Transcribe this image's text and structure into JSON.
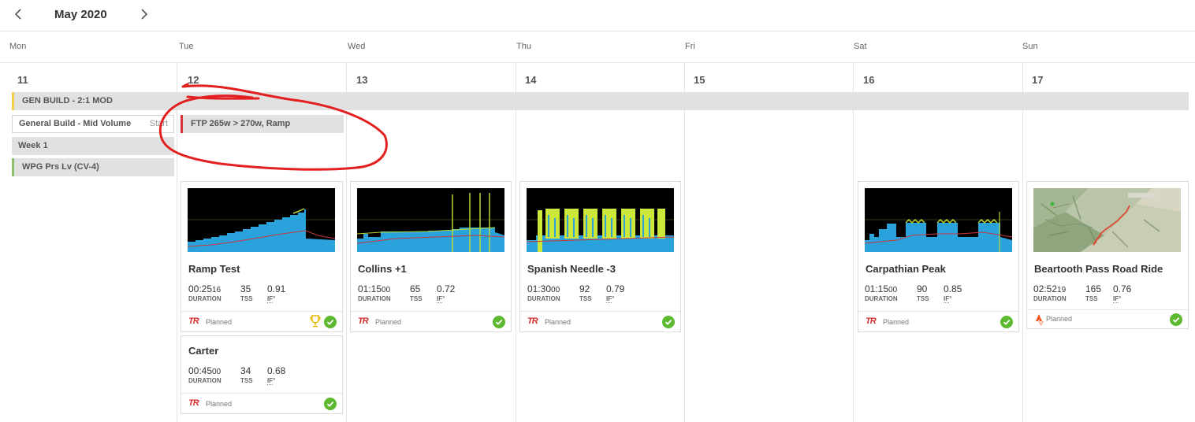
{
  "header": {
    "month": "May 2020",
    "prev_icon": "chevron-left-icon",
    "next_icon": "chevron-right-icon"
  },
  "weekdays": [
    "Mon",
    "Tue",
    "Wed",
    "Thu",
    "Fri",
    "Sat",
    "Sun"
  ],
  "days": [
    "11",
    "12",
    "13",
    "14",
    "15",
    "16",
    "17"
  ],
  "plan": {
    "gen_build": "GEN BUILD - 2:1 MOD",
    "general_build": "General Build - Mid Volume",
    "start": "Start",
    "week": "Week 1",
    "wpg": "WPG Prs Lv (CV-4)",
    "ftp_note": "FTP 265w > 270w, Ramp"
  },
  "labels": {
    "duration": "DURATION",
    "tss": "TSS",
    "if": "IF",
    "planned": "Planned",
    "tr_logo": "TR"
  },
  "workouts": [
    {
      "title": "Ramp Test",
      "dur_main": "00:25",
      "dur_sec": "16",
      "tss": "35",
      "if": "0.91"
    },
    {
      "title": "Carter",
      "dur_main": "00:45",
      "dur_sec": "00",
      "tss": "34",
      "if": "0.68"
    },
    {
      "title": "Collins +1",
      "dur_main": "01:15",
      "dur_sec": "00",
      "tss": "65",
      "if": "0.72"
    },
    {
      "title": "Spanish Needle -3",
      "dur_main": "01:30",
      "dur_sec": "00",
      "tss": "92",
      "if": "0.79"
    },
    {
      "title": "Carpathian Peak",
      "dur_main": "01:15",
      "dur_sec": "00",
      "tss": "90",
      "if": "0.85"
    },
    {
      "title": "Beartooth Pass Road Ride",
      "dur_main": "02:52",
      "dur_sec": "19",
      "tss": "165",
      "if": "0.76"
    }
  ],
  "colors": {
    "accent_red": "#d6343a",
    "check_green": "#5cb930",
    "power_blue": "#2aa3dc",
    "hr_red": "#c8383e",
    "annotation_red": "#e32020"
  },
  "icons": {
    "completed": "check-circle-icon",
    "trophy": "trophy-icon",
    "strava": "strava-icon"
  }
}
